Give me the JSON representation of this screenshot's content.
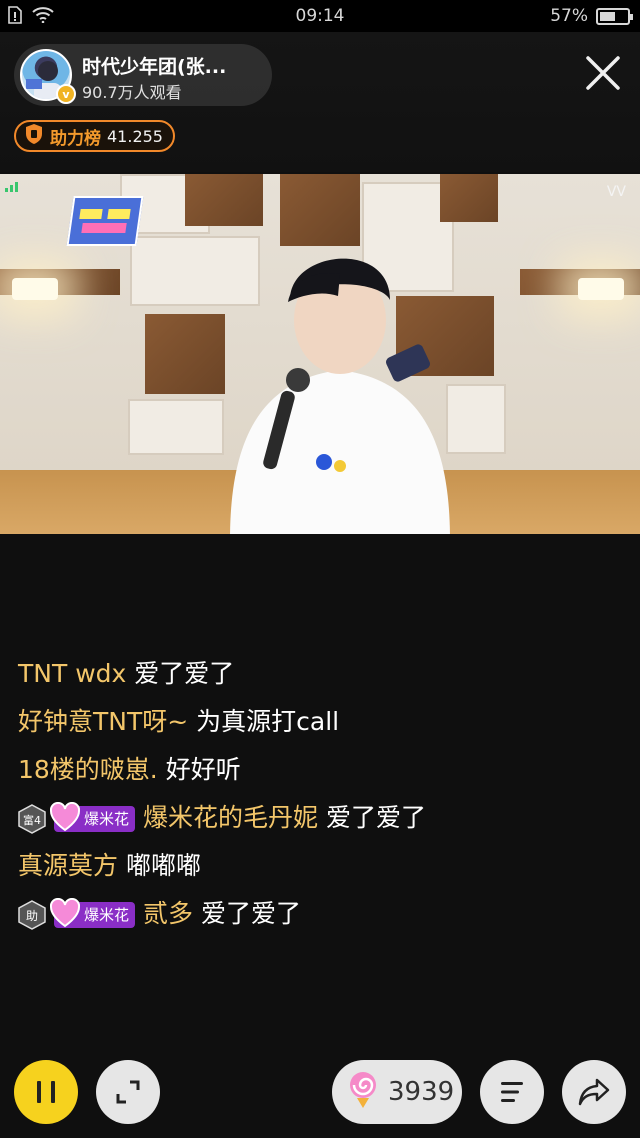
{
  "status_bar": {
    "time": "09:14",
    "battery_percent": "57%",
    "battery_level": 0.57,
    "icons": [
      "sim-icon",
      "wifi-icon",
      "battery-icon"
    ]
  },
  "header": {
    "host_name": "时代少年团(张...",
    "viewers": "90.7万人观看",
    "avatar_badge": "v",
    "support": {
      "label": "助力榜",
      "value": "41.255"
    }
  },
  "video": {
    "overlay_mark": "VV"
  },
  "chat": {
    "messages": [
      {
        "user": "TNT wdx",
        "text": "爱了爱了"
      },
      {
        "user": "好钟意TNT呀~",
        "text": "为真源打call"
      },
      {
        "user": "18楼的啵崽.",
        "text": "好好听"
      },
      {
        "rank": "富4",
        "fan_badge": "爆米花",
        "user": "爆米花的毛丹妮",
        "text": "爱了爱了"
      },
      {
        "user": "真源莫方",
        "text": "嘟嘟嘟"
      },
      {
        "rank": "助",
        "fan_badge": "爆米花",
        "user": "贰多",
        "text": "爱了爱了"
      }
    ]
  },
  "bottom_bar": {
    "gift_count": "3939"
  },
  "colors": {
    "accent_yellow": "#f6d21e",
    "username_gold": "#f3c66a",
    "support_orange": "#f2892a",
    "fan_badge_purple": "#8a2ec6"
  }
}
